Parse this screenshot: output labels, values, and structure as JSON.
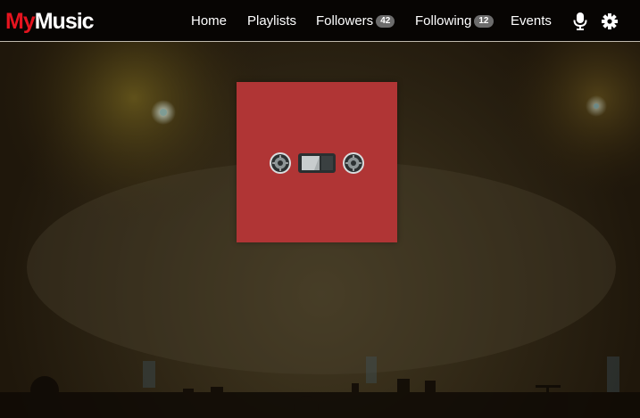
{
  "app": {
    "brand_prefix": "My",
    "brand_suffix": "Music"
  },
  "nav": {
    "home": "Home",
    "playlists": "Playlists",
    "followers": "Followers",
    "followers_count": "42",
    "following": "Following",
    "following_count": "12",
    "events": "Events"
  },
  "icons": {
    "mic": "microphone-icon",
    "settings": "gear-icon",
    "cover": "cassette-tape-icon"
  },
  "colors": {
    "brand_red": "#e5141f",
    "cover_background": "#b03535",
    "badge": "#6c6c6c"
  }
}
